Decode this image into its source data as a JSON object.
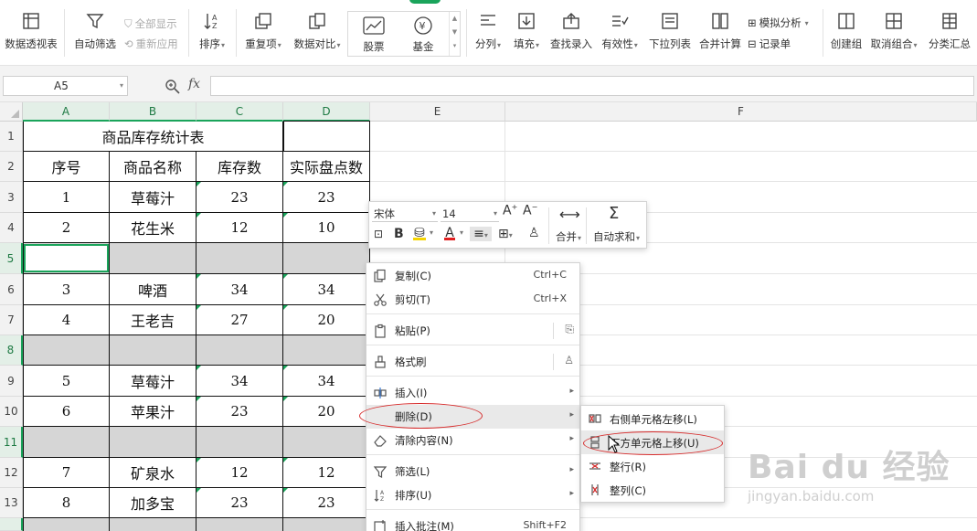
{
  "ribbon": {
    "pivot_table": "数据透视表",
    "auto_filter": "自动筛选",
    "show_all": "全部显示",
    "reapply": "重新应用",
    "sort": "排序",
    "duplicates": "重复项",
    "data_compare": "数据对比",
    "stocks": "股票",
    "fund": "基金",
    "split_column": "分列",
    "fill": "填充",
    "find_entry": "查找录入",
    "validity": "有效性",
    "dropdown_list": "下拉列表",
    "merge_calc": "合并计算",
    "what_if": "模拟分析",
    "record_sheet": "记录单",
    "create_group": "创建组",
    "ungroup": "取消组合",
    "subtotal": "分类汇总"
  },
  "formula_bar": {
    "name_box": "A5",
    "fx_label": "fx",
    "formula": ""
  },
  "columns": [
    "A",
    "B",
    "C",
    "D",
    "E",
    "F"
  ],
  "rows": [
    "1",
    "2",
    "3",
    "4",
    "5",
    "6",
    "7",
    "8",
    "9",
    "10",
    "11",
    "12",
    "13"
  ],
  "table": {
    "title": "商品库存统计表",
    "headers": [
      "序号",
      "商品名称",
      "库存数",
      "实际盘点数"
    ],
    "rows": [
      {
        "no": "1",
        "name": "草莓汁",
        "stock": "23",
        "count": "23"
      },
      {
        "no": "2",
        "name": "花生米",
        "stock": "12",
        "count": "10"
      },
      {
        "no": "3",
        "name": "啤酒",
        "stock": "34",
        "count": "34"
      },
      {
        "no": "4",
        "name": "王老吉",
        "stock": "27",
        "count": "20"
      },
      {
        "no": "5",
        "name": "草莓汁",
        "stock": "34",
        "count": "34"
      },
      {
        "no": "6",
        "name": "苹果汁",
        "stock": "23",
        "count": "20"
      },
      {
        "no": "7",
        "name": "矿泉水",
        "stock": "12",
        "count": "12"
      },
      {
        "no": "8",
        "name": "加多宝",
        "stock": "23",
        "count": "23"
      }
    ]
  },
  "mini_toolbar": {
    "font": "宋体",
    "size": "14",
    "merge": "合并",
    "autosum": "自动求和"
  },
  "context_menu": {
    "copy": "复制(C)",
    "copy_shortcut": "Ctrl+C",
    "cut": "剪切(T)",
    "cut_shortcut": "Ctrl+X",
    "paste": "粘贴(P)",
    "format_painter": "格式刷",
    "insert": "插入(I)",
    "delete": "删除(D)",
    "clear": "清除内容(N)",
    "filter": "筛选(L)",
    "sort": "排序(U)",
    "insert_comment": "插入批注(M)",
    "insert_comment_shortcut": "Shift+F2"
  },
  "submenu": {
    "shift_left": "右侧单元格左移(L)",
    "shift_up": "下方单元格上移(U)",
    "entire_row": "整行(R)",
    "entire_col": "整列(C)"
  },
  "watermark": {
    "brand": "Bai du 经验",
    "url": "jingyan.baidu.com"
  },
  "colors": {
    "accent": "#1aa45b",
    "highlight_oval": "#d62b2b",
    "gray_row": "#d6d6d6"
  }
}
